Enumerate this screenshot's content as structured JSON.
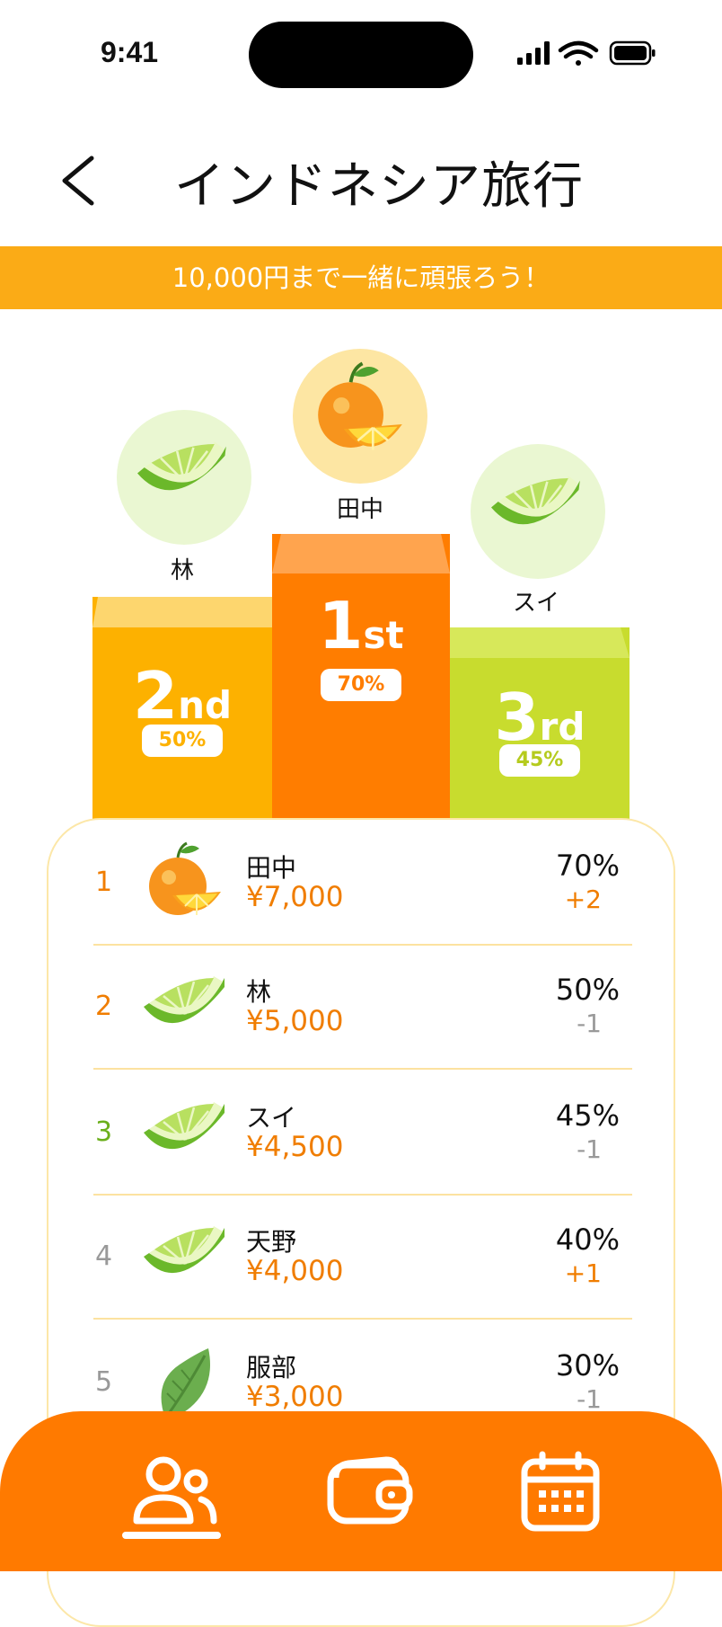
{
  "status": {
    "time": "9:41"
  },
  "header": {
    "title": "インドネシア旅行"
  },
  "banner": {
    "text": "10,000円まで一緒に頑張ろう！"
  },
  "podium": {
    "first": {
      "name": "田中",
      "rank_num": "1",
      "rank_suffix": "st",
      "percent": "70%",
      "icon": "orange-icon"
    },
    "second": {
      "name": "林",
      "rank_num": "2",
      "rank_suffix": "nd",
      "percent": "50%",
      "icon": "lime-slice-icon"
    },
    "third": {
      "name": "スイ",
      "rank_num": "3",
      "rank_suffix": "rd",
      "percent": "45%",
      "icon": "lime-slice-icon"
    }
  },
  "ranking": [
    {
      "rank": "1",
      "name": "田中",
      "amount": "¥7,000",
      "percent": "70%",
      "delta": "+2",
      "icon": "orange-icon"
    },
    {
      "rank": "2",
      "name": "林",
      "amount": "¥5,000",
      "percent": "50%",
      "delta": "-1",
      "icon": "lime-slice-icon"
    },
    {
      "rank": "3",
      "name": "スイ",
      "amount": "¥4,500",
      "percent": "45%",
      "delta": "-1",
      "icon": "lime-slice-icon"
    },
    {
      "rank": "4",
      "name": "天野",
      "amount": "¥4,000",
      "percent": "40%",
      "delta": "+1",
      "icon": "lime-slice-icon"
    },
    {
      "rank": "5",
      "name": "服部",
      "amount": "¥3,000",
      "percent": "30%",
      "delta": "-1",
      "icon": "leaf-icon"
    }
  ],
  "nav": {
    "items": [
      "members-icon",
      "wallet-icon",
      "calendar-icon"
    ],
    "active": "members-icon"
  },
  "colors": {
    "orange": "#FF7A00",
    "banner": "#FBAB16",
    "second": "#FDB100",
    "third": "#C8DC2E",
    "up": "#F07D00",
    "down": "#999999",
    "rank_green": "#6BAF1C"
  }
}
